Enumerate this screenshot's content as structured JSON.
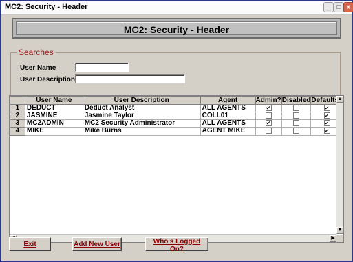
{
  "window": {
    "title": "MC2: Security - Header",
    "min_glyph": "_",
    "max_glyph": "□",
    "close_glyph": "x"
  },
  "header": {
    "title": "MC2: Security - Header"
  },
  "searches": {
    "legend": "Searches",
    "user_name_label": "User Name",
    "user_name_value": "",
    "user_description_label": "User Description",
    "user_description_value": ""
  },
  "grid": {
    "columns": [
      "User Name",
      "User Description",
      "Agent",
      "Admin?",
      "Disabled",
      "Defaults?"
    ],
    "rows": [
      {
        "num": "1",
        "user_name": "DEDUCT",
        "user_description": "Deduct Analyst",
        "agent": "ALL AGENTS",
        "admin": true,
        "disabled": false,
        "defaults": true
      },
      {
        "num": "2",
        "user_name": "JASMINE",
        "user_description": "Jasmine Taylor",
        "agent": "COLL01",
        "admin": false,
        "disabled": false,
        "defaults": true
      },
      {
        "num": "3",
        "user_name": "MC2ADMIN",
        "user_description": "MC2 Security Administrator",
        "agent": "ALL AGENTS",
        "admin": true,
        "disabled": false,
        "defaults": true
      },
      {
        "num": "4",
        "user_name": "MIKE",
        "user_description": "Mike Burns",
        "agent": "AGENT MIKE",
        "admin": false,
        "disabled": false,
        "defaults": true
      }
    ]
  },
  "buttons": {
    "exit": "Exit",
    "add_new_user": "Add New User",
    "whos_logged_on": "Who's Logged On?"
  }
}
